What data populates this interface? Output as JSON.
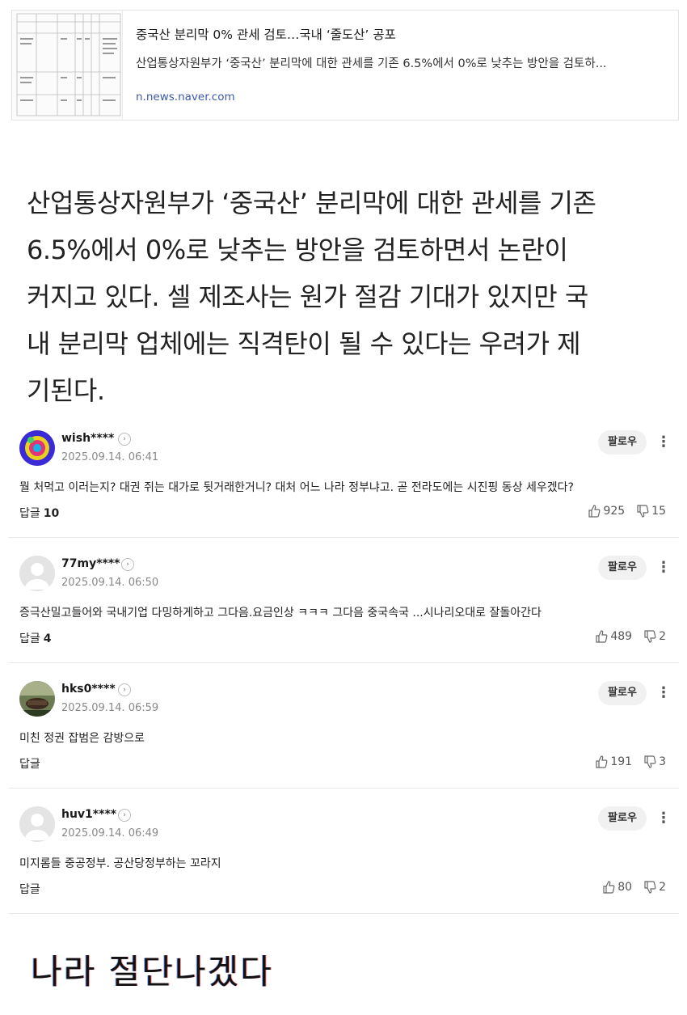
{
  "preview_card": {
    "title": "중국산 분리막 0% 관세 검토…국내 ‘줄도산’ 공포",
    "description": "산업통상자원부가 ‘중국산’ 분리막에 대한 관세를 기존 6.5%에서 0%로 낮추는 방안을 검토하...",
    "domain": "n.news.naver.com"
  },
  "article": {
    "lines": [
      "산업통상자원부가 ‘중국산’ 분리막에 대한 관세를 기존",
      "6.5%에서 0%로 낮추는 방안을 검토하면서 논란이",
      "커지고 있다. 셀 제조사는 원가 절감 기대가 있지만 국",
      "내 분리막 업체에는 직격탄이 될 수 있다는 우려가 제",
      "기된다."
    ]
  },
  "comments": [
    {
      "user": "wish****",
      "date": "2025.09.14. 06:41",
      "follow_label": "팔로우",
      "text": "뭘 처먹고 이러는지? 대권 쥐는 대가로 뒷거래한거니? 대처 어느 나라 정부냐고. 곧 전라도에는 시진핑 동상 세우겠다?",
      "reply_label": "답글",
      "reply_count": "10",
      "likes": "925",
      "dislikes": "15",
      "avatar": "colorful-icon"
    },
    {
      "user": "77my****",
      "date": "2025.09.14. 06:50",
      "follow_label": "팔로우",
      "text": "증극산밀고들어와 국내기업 다밍하게하고 그다음.요금인상 ㅋㅋㅋ 그다음 중국속국 ...시나리오대로 잘돌아간다",
      "reply_label": "답글",
      "reply_count": "4",
      "likes": "489",
      "dislikes": "2",
      "avatar": "default-user-icon"
    },
    {
      "user": "hks0****",
      "date": "2025.09.14. 06:59",
      "follow_label": "팔로우",
      "text": "미친 정권 잡범은 감방으로",
      "reply_label": "답글",
      "reply_count": "",
      "likes": "191",
      "dislikes": "3",
      "avatar": "photo-icon"
    },
    {
      "user": "huv1****",
      "date": "2025.09.14. 06:49",
      "follow_label": "팔로우",
      "text": "미지롬들 중공정부. 공산당정부하는 꼬라지",
      "reply_label": "답글",
      "reply_count": "",
      "likes": "80",
      "dislikes": "2",
      "avatar": "default-user-icon"
    }
  ],
  "footer": {
    "text": "나라 절단나겠다"
  }
}
